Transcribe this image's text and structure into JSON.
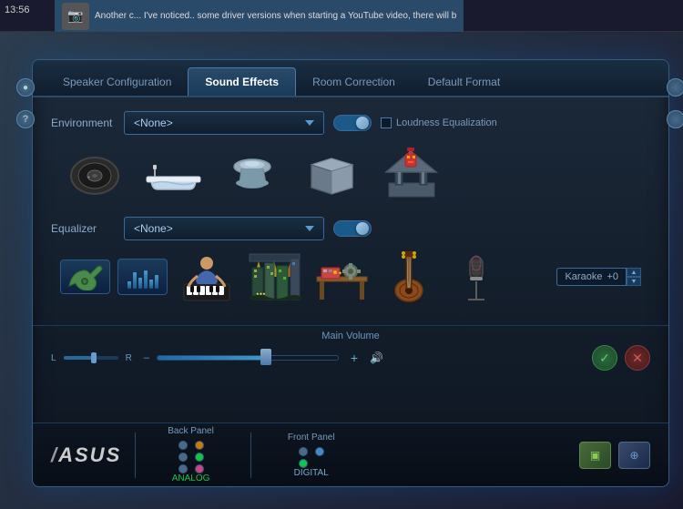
{
  "taskbar": {
    "time": "13:56",
    "notification_text": "Another c... I've noticed.. some driver versions when starting a YouTube video, there will b"
  },
  "tabs": [
    {
      "id": "speaker",
      "label": "Speaker Configuration"
    },
    {
      "id": "effects",
      "label": "Sound Effects",
      "active": true
    },
    {
      "id": "room",
      "label": "Room Correction"
    },
    {
      "id": "format",
      "label": "Default Format"
    }
  ],
  "sound_effects": {
    "environment_label": "Environment",
    "environment_value": "<None>",
    "equalizer_label": "Equalizer",
    "equalizer_value": "<None>",
    "loudness_label": "Loudness Equalization",
    "volume_label": "Main Volume",
    "l_label": "L",
    "r_label": "R",
    "plus_symbol": "+",
    "karaoke_label": "Karaoke",
    "karaoke_value": "+0",
    "environment_icons": [
      {
        "name": "disc",
        "symbol": "💿"
      },
      {
        "name": "bathtub",
        "symbol": "🛁"
      },
      {
        "name": "plate",
        "symbol": "🍽️"
      },
      {
        "name": "box",
        "symbol": "📦"
      },
      {
        "name": "temple",
        "symbol": "🏛️"
      }
    ],
    "eq_icons": [
      {
        "name": "guitar-small",
        "symbol": "🎸"
      },
      {
        "name": "eq-bars",
        "type": "bars"
      },
      {
        "name": "pianist",
        "symbol": "🎹"
      },
      {
        "name": "stage",
        "symbol": "🎭"
      },
      {
        "name": "workbench",
        "symbol": "🔧"
      },
      {
        "name": "guitar-large",
        "symbol": "🎸"
      },
      {
        "name": "microphone",
        "symbol": "🎤"
      }
    ]
  },
  "bottom_panel": {
    "brand": "ASUS",
    "back_panel_label": "Back Panel",
    "front_panel_label": "Front Panel",
    "analog_label": "ANALOG",
    "digital_label": "DIGITAL"
  },
  "confirm": {
    "ok_symbol": "✓",
    "cancel_symbol": "✕"
  }
}
